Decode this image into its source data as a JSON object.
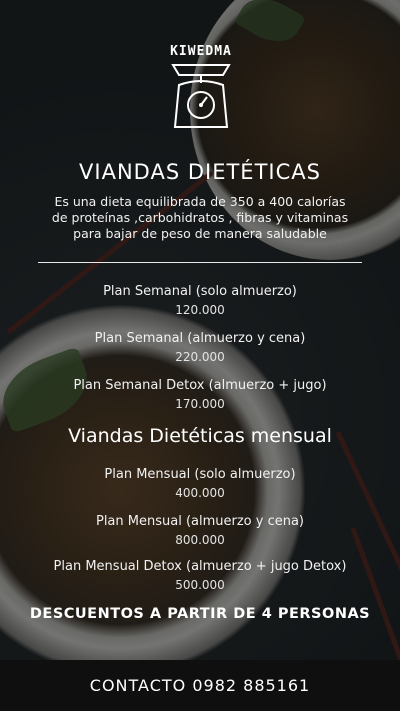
{
  "logo": {
    "text": "KIWEDMA"
  },
  "header": {
    "title": "VIANDAS DIETÉTICAS"
  },
  "description": {
    "line1": "Es una dieta equilibrada de 350 a 400 calorías",
    "line2": "de proteínas ,carbohidratos , fibras y vitaminas",
    "line3": "para bajar de peso de manera saludable"
  },
  "weekly_plans": [
    {
      "name": "Plan Semanal (solo almuerzo)",
      "price": "120.000"
    },
    {
      "name": "Plan Semanal (almuerzo y cena)",
      "price": "220.000"
    },
    {
      "name": "Plan Semanal Detox (almuerzo + jugo)",
      "price": "170.000"
    }
  ],
  "monthly": {
    "title": "Viandas Dietéticas mensual",
    "plans": [
      {
        "name": "Plan Mensual (solo almuerzo)",
        "price": "400.000"
      },
      {
        "name": "Plan Mensual (almuerzo y cena)",
        "price": "800.000"
      },
      {
        "name": "Plan Mensual Detox (almuerzo + jugo Detox)",
        "price": "500.000"
      }
    ]
  },
  "discount": "DESCUENTOS A PARTIR DE 4 PERSONAS",
  "footer": {
    "contact": "CONTACTO 0982 885161"
  },
  "icons": {
    "logo": "kitchen-scale-icon"
  }
}
